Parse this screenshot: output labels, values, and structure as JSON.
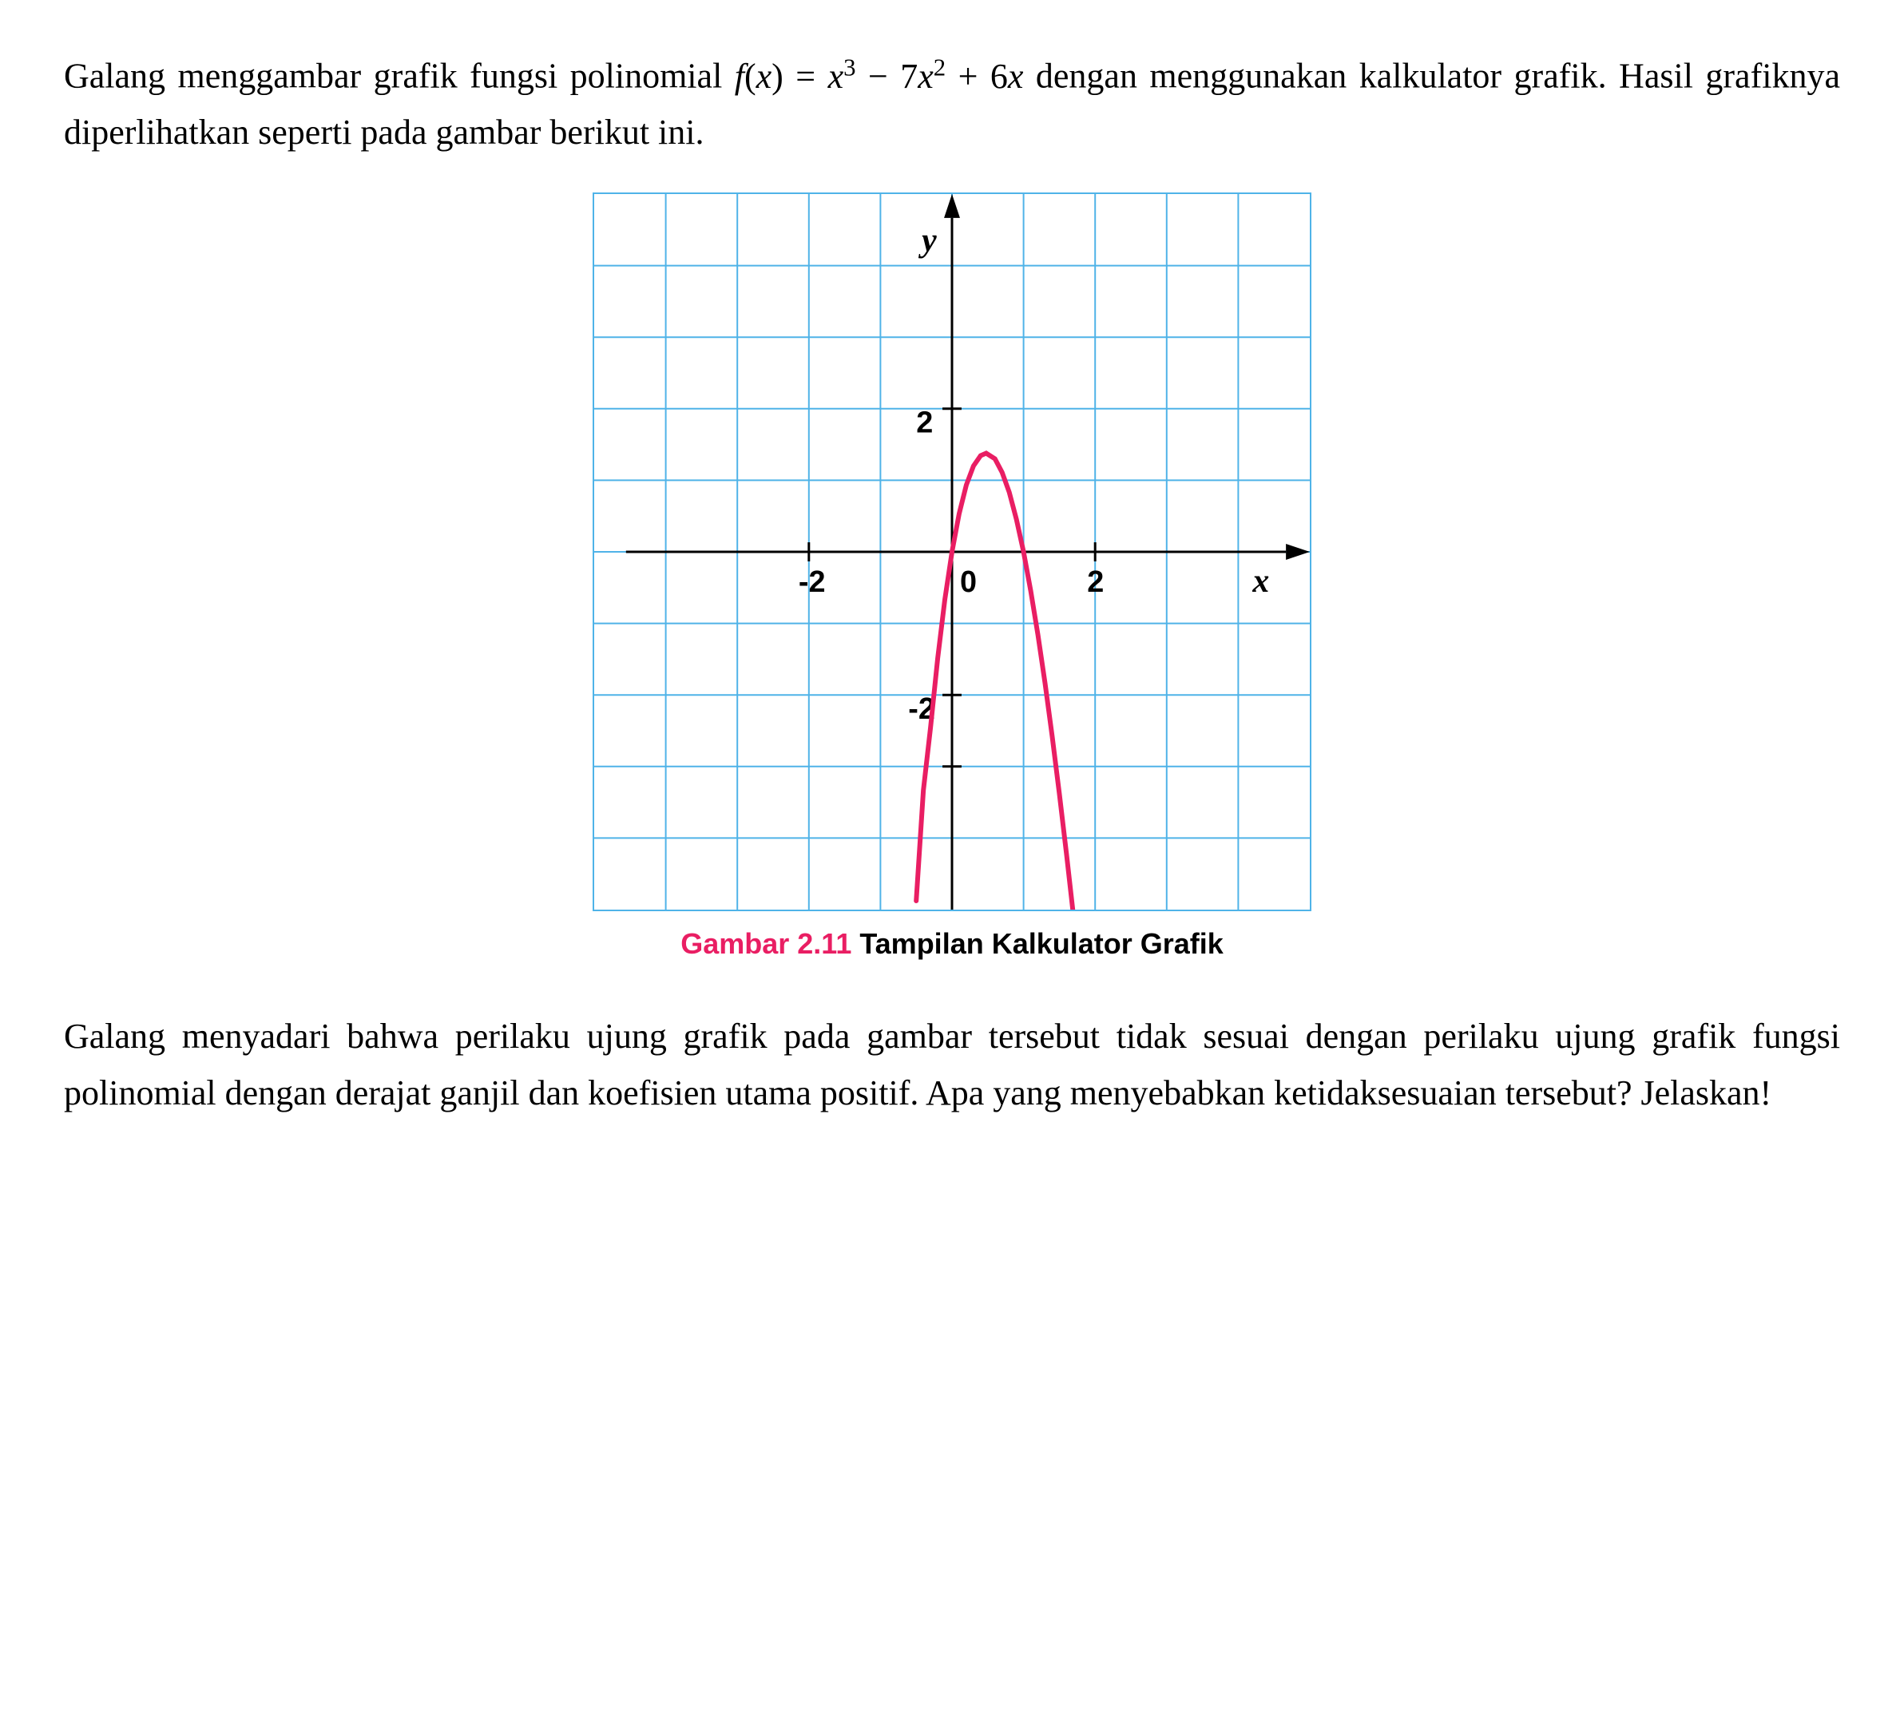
{
  "paragraph1_pre": "Galang menggambar grafik fungsi polinomial ",
  "formula": {
    "fname": "f",
    "lparen": "(",
    "var": "x",
    "rparen": ")",
    "eq": " = ",
    "term1_base": "x",
    "term1_exp": "3",
    "minus": " − 7",
    "term2_base": "x",
    "term2_exp": "2",
    "plus": " + 6",
    "term3_base": "x"
  },
  "paragraph1_post": " dengan menggunakan kalkulator grafik. Hasil grafiknya diperlihatkan seperti pada gambar berikut ini.",
  "caption_prefix": "Gambar 2.11",
  "caption_text": " Tampilan Kalkulator Grafik",
  "paragraph2": "Galang menyadari bahwa perilaku ujung grafik pada gambar tersebut tidak sesuai dengan perilaku ujung grafik fungsi polinomial dengan derajat ganjil dan koefisien utama positif. Apa yang menyebabkan ketidaksesuaian tersebut? Jelaskan!",
  "chart_data": {
    "type": "line",
    "function": "f(x) = x^3 - 7x^2 + 6x",
    "xlabel": "x",
    "ylabel": "y",
    "x_ticks": [
      -2,
      0,
      2
    ],
    "y_ticks": [
      -2,
      2
    ],
    "xlim": [
      -5,
      5
    ],
    "ylim": [
      -5,
      5
    ],
    "visible_curve_points": [
      {
        "x": 0.0,
        "y": 0.0
      },
      {
        "x": 0.1,
        "y": 0.53
      },
      {
        "x": 0.2,
        "y": 0.93
      },
      {
        "x": 0.3,
        "y": 1.2
      },
      {
        "x": 0.4,
        "y": 1.34
      },
      {
        "x": 0.47,
        "y": 1.38
      },
      {
        "x": 0.6,
        "y": 1.3
      },
      {
        "x": 0.7,
        "y": 1.11
      },
      {
        "x": 0.8,
        "y": 0.83
      },
      {
        "x": 0.9,
        "y": 0.46
      },
      {
        "x": 1.0,
        "y": 0.0
      },
      {
        "x": 1.1,
        "y": -0.54
      },
      {
        "x": 1.2,
        "y": -1.15
      },
      {
        "x": 1.3,
        "y": -1.83
      },
      {
        "x": 1.4,
        "y": -2.58
      },
      {
        "x": 1.5,
        "y": -3.38
      },
      {
        "x": 1.6,
        "y": -4.22
      },
      {
        "x": 1.7,
        "y": -5.12
      }
    ],
    "visible_curve_points_left": [
      {
        "x": 0.0,
        "y": 0.0
      },
      {
        "x": -0.1,
        "y": -0.67
      },
      {
        "x": -0.2,
        "y": -1.49
      },
      {
        "x": -0.3,
        "y": -2.46
      },
      {
        "x": -0.4,
        "y": -3.58
      },
      {
        "x": -0.5,
        "y": -4.88
      }
    ]
  },
  "axis_labels": {
    "x": "x",
    "y": "y"
  },
  "tick_labels": {
    "xm2": "-2",
    "x0": "0",
    "x2": "2",
    "y2": "2",
    "ym2": "-2"
  }
}
